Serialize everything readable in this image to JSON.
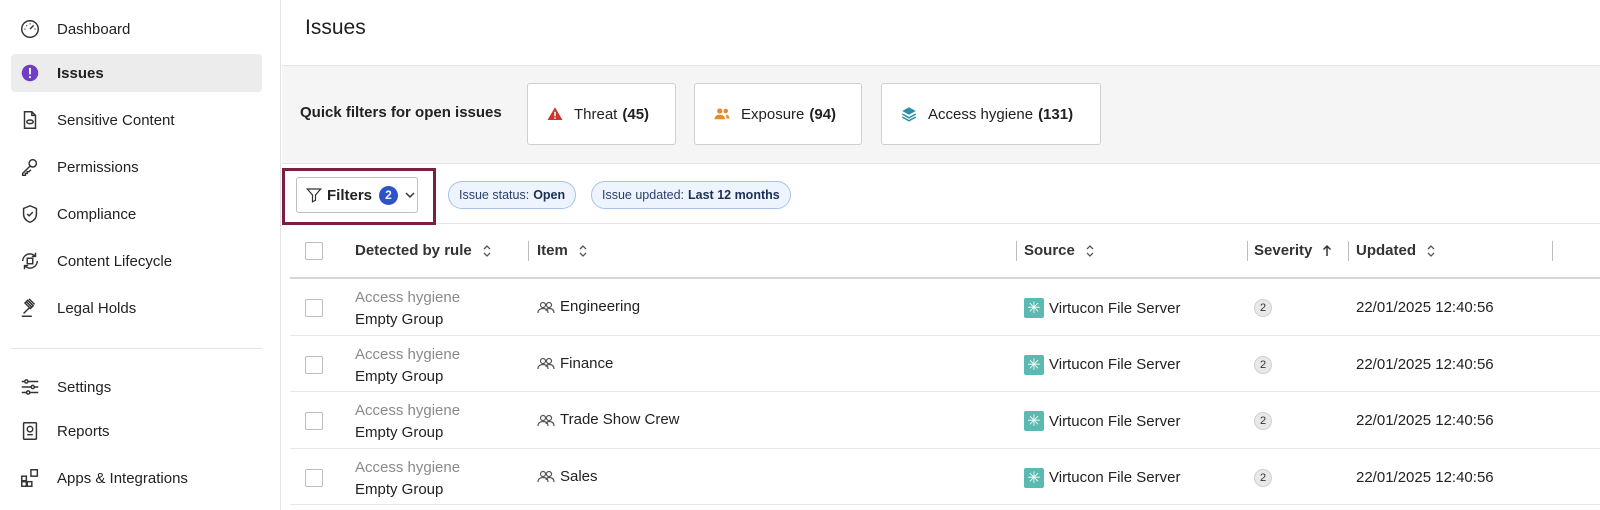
{
  "sidebar": {
    "items": [
      {
        "label": "Dashboard",
        "icon": "gauge-icon"
      },
      {
        "label": "Issues",
        "icon": "alert-circle-icon",
        "active": true
      },
      {
        "label": "Sensitive Content",
        "icon": "document-eye-icon"
      },
      {
        "label": "Permissions",
        "icon": "key-icon"
      },
      {
        "label": "Compliance",
        "icon": "shield-check-icon"
      },
      {
        "label": "Content Lifecycle",
        "icon": "lifecycle-icon"
      },
      {
        "label": "Legal Holds",
        "icon": "gavel-icon"
      }
    ],
    "bottom_items": [
      {
        "label": "Settings",
        "icon": "sliders-icon"
      },
      {
        "label": "Reports",
        "icon": "report-icon"
      },
      {
        "label": "Apps & Integrations",
        "icon": "apps-icon"
      }
    ]
  },
  "header": {
    "title": "Issues"
  },
  "quick_filters": {
    "label": "Quick filters for open issues",
    "items": [
      {
        "label": "Threat",
        "count": "(45)",
        "icon": "warning-triangle-icon",
        "color": "#d0342c"
      },
      {
        "label": "Exposure",
        "count": "(94)",
        "icon": "users-icon",
        "color": "#e8892b"
      },
      {
        "label": "Access hygiene",
        "count": "(131)",
        "icon": "layers-icon",
        "color": "#2a8fa8"
      }
    ]
  },
  "filters": {
    "label": "Filters",
    "badge": "2",
    "chips": [
      {
        "key": "Issue status:",
        "value": "Open"
      },
      {
        "key": "Issue updated:",
        "value": "Last 12 months"
      }
    ]
  },
  "table": {
    "columns": [
      {
        "label": "Detected by rule",
        "sort": "none"
      },
      {
        "label": "Item",
        "sort": "none"
      },
      {
        "label": "Source",
        "sort": "none"
      },
      {
        "label": "Severity",
        "sort": "ascending"
      },
      {
        "label": "Updated",
        "sort": "none"
      }
    ],
    "rows": [
      {
        "rule_category": "Access hygiene",
        "rule_name": "Empty Group",
        "item": "Engineering",
        "source": "Virtucon File Server",
        "severity": "2",
        "updated": "22/01/2025 12:40:56"
      },
      {
        "rule_category": "Access hygiene",
        "rule_name": "Empty Group",
        "item": "Finance",
        "source": "Virtucon File Server",
        "severity": "2",
        "updated": "22/01/2025 12:40:56"
      },
      {
        "rule_category": "Access hygiene",
        "rule_name": "Empty Group",
        "item": "Trade Show Crew",
        "source": "Virtucon File Server",
        "severity": "2",
        "updated": "22/01/2025 12:40:56"
      },
      {
        "rule_category": "Access hygiene",
        "rule_name": "Empty Group",
        "item": "Sales",
        "source": "Virtucon File Server",
        "severity": "2",
        "updated": "22/01/2025 12:40:56"
      }
    ]
  },
  "colors": {
    "accent": "#2d53c9",
    "highlight_border": "#7a1f42",
    "source_icon": "#5ab9b0",
    "issues_icon": "#6e3fc6"
  }
}
